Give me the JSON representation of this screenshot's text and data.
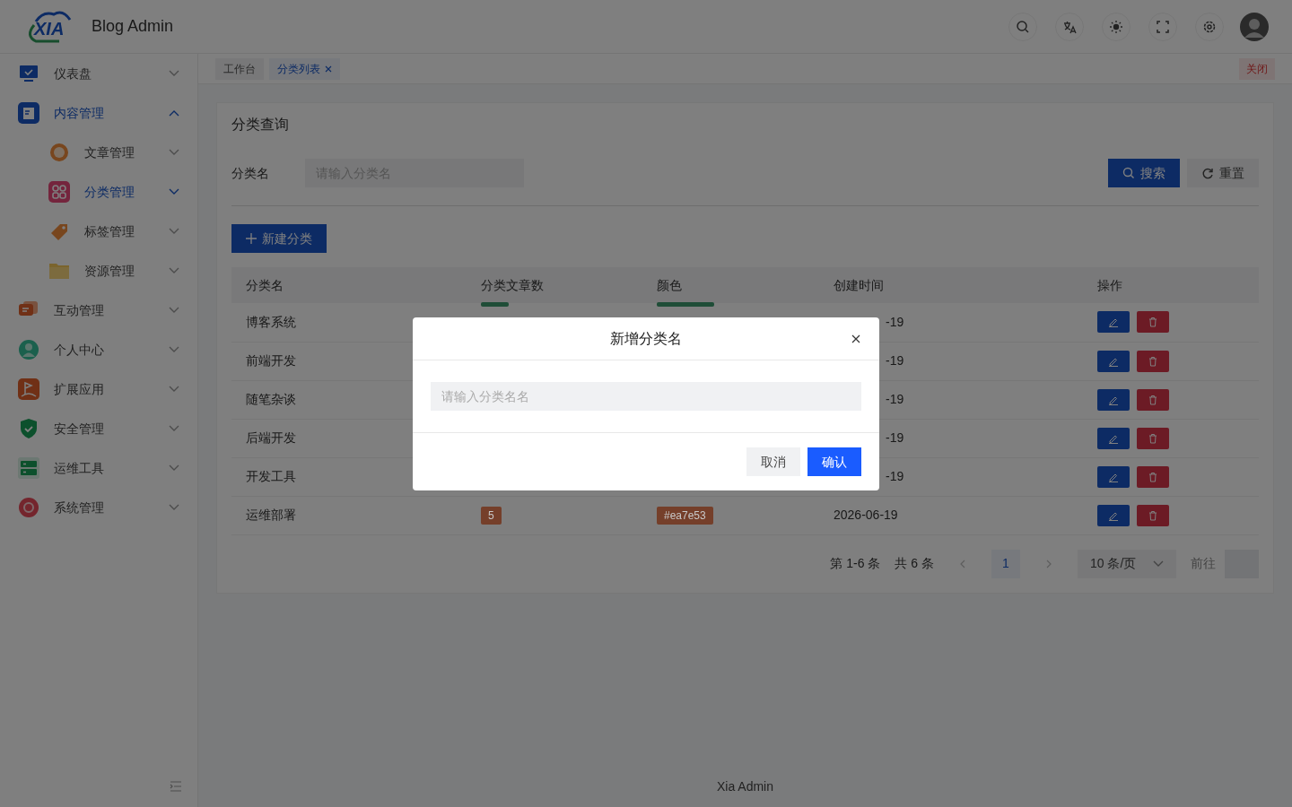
{
  "header": {
    "logo_text": "XIA",
    "title": "Blog Admin"
  },
  "sidebar": {
    "items": [
      {
        "label": "仪表盘",
        "expanded": false,
        "selected": false
      },
      {
        "label": "内容管理",
        "expanded": true,
        "selected": true,
        "children": [
          {
            "label": "文章管理",
            "expanded": false,
            "selected": false
          },
          {
            "label": "分类管理",
            "expanded": false,
            "selected": true
          },
          {
            "label": "标签管理",
            "expanded": false,
            "selected": false
          },
          {
            "label": "资源管理",
            "expanded": false,
            "selected": false
          }
        ]
      },
      {
        "label": "互动管理",
        "expanded": false,
        "selected": false
      },
      {
        "label": "个人中心",
        "expanded": false,
        "selected": false
      },
      {
        "label": "扩展应用",
        "expanded": false,
        "selected": false
      },
      {
        "label": "安全管理",
        "expanded": false,
        "selected": false
      },
      {
        "label": "运维工具",
        "expanded": false,
        "selected": false
      },
      {
        "label": "系统管理",
        "expanded": false,
        "selected": false
      }
    ]
  },
  "tabs": [
    {
      "label": "工作台",
      "selected": false
    },
    {
      "label": "分类列表",
      "selected": true,
      "closable": true
    }
  ],
  "close_all": "关闭",
  "query": {
    "title": "分类查询",
    "label": "分类名",
    "placeholder": "请输入分类名",
    "search": "搜索",
    "reset": "重置"
  },
  "new_button": "新建分类",
  "table": {
    "columns": [
      "分类名",
      "分类文章数",
      "颜色",
      "创建时间",
      "操作"
    ],
    "rows": [
      {
        "name": "博客系统",
        "covered": true,
        "color": "#1f4d37",
        "date": "-19"
      },
      {
        "name": "前端开发",
        "covered": true,
        "date": "-19"
      },
      {
        "name": "随笔杂谈",
        "covered": true,
        "date": "-19"
      },
      {
        "name": "后端开发",
        "covered": true,
        "date": "-19"
      },
      {
        "name": "开发工具",
        "covered": true,
        "date": "-19"
      },
      {
        "name": "运维部署",
        "covered": false,
        "count": "5",
        "color": "#753f2a",
        "color_label": "#ea7e53",
        "date": "2026-06-19"
      }
    ]
  },
  "pagination": {
    "range": "第 1-6 条",
    "total": "共 6 条",
    "pages": [
      {
        "label": "1",
        "selected": true
      }
    ],
    "page_size": "10 条/页",
    "goto": "前往"
  },
  "footer": "Xia Admin",
  "modal": {
    "title": "新增分类名",
    "placeholder": "请输入分类名名",
    "cancel": "取消",
    "confirm": "确认"
  }
}
